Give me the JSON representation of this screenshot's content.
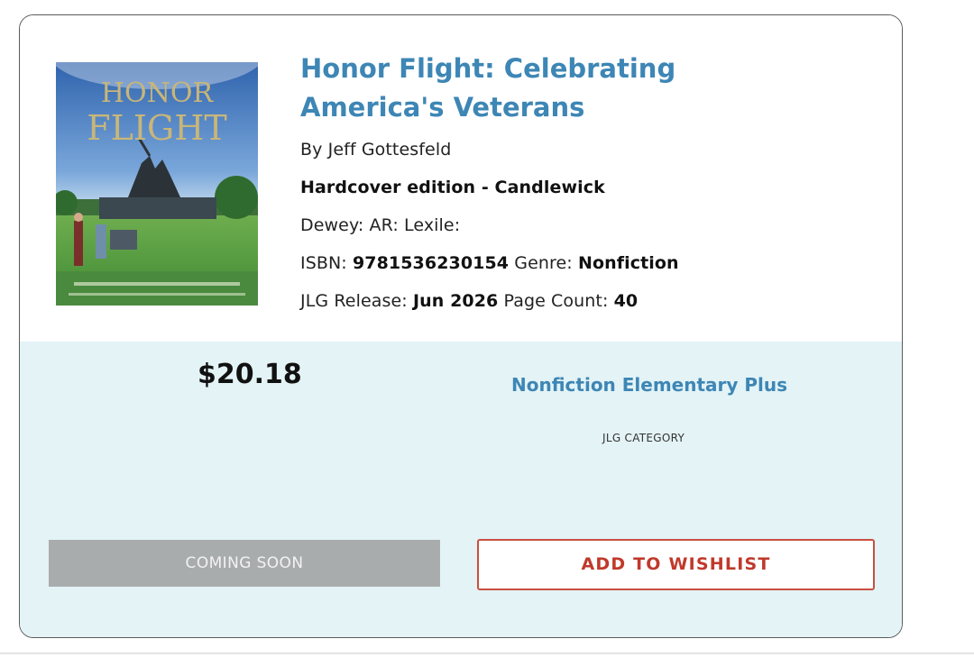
{
  "book": {
    "title": "Honor Flight: Celebrating America's Veterans",
    "author_line": "By Jeff Gottesfeld",
    "edition_line": "Hardcover edition - Candlewick",
    "dewey_line": "Dewey: AR: Lexile:",
    "isbn_label": "ISBN: ",
    "isbn_value": "9781536230154",
    "genre_label": " Genre: ",
    "genre_value": "Nonfiction",
    "release_label": "JLG Release: ",
    "release_value": "Jun 2026",
    "page_count_label": " Page Count: ",
    "page_count_value": "40",
    "cover": {
      "title_line_1": "HONOR",
      "title_line_2": "FLIGHT"
    }
  },
  "purchase": {
    "price": "$20.18",
    "category_name": "Nonfiction Elementary Plus",
    "category_label": "JLG CATEGORY",
    "coming_soon_label": "COMING SOON",
    "wishlist_label": "ADD TO WISHLIST"
  },
  "colors": {
    "title_blue": "#3d86b5",
    "panel_bg": "#e3f3f6",
    "wishlist_red": "#c0392b",
    "disabled_gray": "#a9acad"
  }
}
